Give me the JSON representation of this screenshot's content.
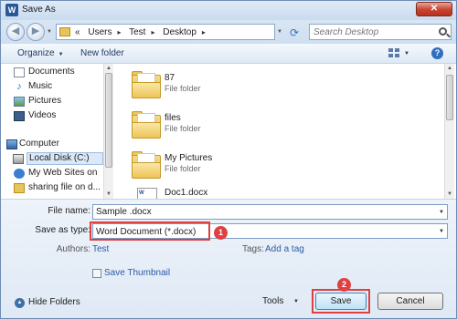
{
  "window": {
    "title": "Save As",
    "app_icon": "W",
    "close_glyph": "✕"
  },
  "address": {
    "crumbs": [
      "«",
      "Users",
      "Test",
      "Desktop"
    ],
    "search_placeholder": "Search Desktop"
  },
  "toolbar": {
    "organize": "Organize",
    "new_folder": "New folder",
    "help": "?"
  },
  "nav": {
    "items": [
      {
        "label": "Documents",
        "icon": "documents-icon"
      },
      {
        "label": "Music",
        "icon": "music-icon"
      },
      {
        "label": "Pictures",
        "icon": "pictures-icon"
      },
      {
        "label": "Videos",
        "icon": "videos-icon"
      },
      {
        "label": "Computer",
        "icon": "computer-icon"
      },
      {
        "label": "Local Disk (C:)",
        "icon": "disk-icon"
      },
      {
        "label": "My Web Sites on",
        "icon": "globe-icon"
      },
      {
        "label": "sharing file on d...",
        "icon": "share-folder-icon"
      }
    ]
  },
  "files": [
    {
      "name": "87",
      "type": "File folder"
    },
    {
      "name": "files",
      "type": "File folder"
    },
    {
      "name": "My Pictures",
      "type": "File folder"
    },
    {
      "name": "Doc1.docx",
      "type": ""
    }
  ],
  "form": {
    "file_name_label": "File name:",
    "file_name_value": "Sample .docx",
    "save_as_type_label": "Save as type:",
    "save_as_type_value": "Word Document (*.docx)",
    "authors_label": "Authors:",
    "authors_value": "Test",
    "tags_label": "Tags:",
    "tags_value": "Add a tag",
    "thumbnail_label": "Save Thumbnail"
  },
  "footer": {
    "hide_folders": "Hide Folders",
    "tools": "Tools",
    "save": "Save",
    "cancel": "Cancel"
  },
  "annotations": {
    "badge1": "1",
    "badge2": "2"
  },
  "colors": {
    "accent": "#2a5ba8",
    "highlight": "#e04040",
    "title_bar": "#c9dbef"
  }
}
